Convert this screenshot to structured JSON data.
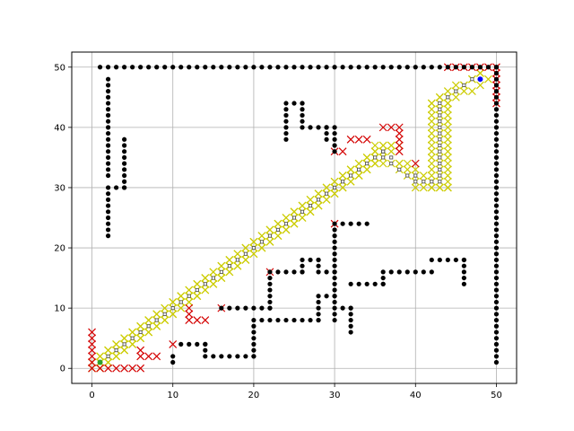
{
  "chart_data": {
    "type": "scatter",
    "title": "",
    "xlabel": "",
    "ylabel": "",
    "xlim": [
      -2.5,
      52.5
    ],
    "ylim": [
      -2.5,
      52.5
    ],
    "grid": true,
    "xticks": [
      0,
      10,
      20,
      30,
      40,
      50
    ],
    "yticks": [
      0,
      10,
      20,
      30,
      40,
      50
    ],
    "colors": {
      "obstacles": "#000000",
      "closed_set": "#cccc00",
      "open_set": "#d40000",
      "path": "#555555",
      "start": "#2ca02c",
      "goal": "#0000ff"
    },
    "series": [
      {
        "marker": "dot",
        "segments": [
          [
            [
              1,
              50
            ],
            [
              50,
              50
            ]
          ],
          [
            [
              50,
              50
            ],
            [
              50,
              1
            ]
          ],
          [
            [
              2,
              48
            ],
            [
              2,
              32
            ]
          ],
          [
            [
              2,
              30
            ],
            [
              2,
              22
            ]
          ],
          [
            [
              3,
              30
            ],
            [
              4,
              30
            ]
          ],
          [
            [
              4,
              38
            ],
            [
              4,
              30
            ]
          ],
          [
            [
              24,
              44
            ],
            [
              24,
              38
            ]
          ],
          [
            [
              25,
              44
            ],
            [
              26,
              44
            ]
          ],
          [
            [
              26,
              44
            ],
            [
              26,
              40
            ]
          ],
          [
            [
              27,
              40
            ],
            [
              29,
              40
            ]
          ],
          [
            [
              29,
              40
            ],
            [
              29,
              38
            ]
          ],
          [
            [
              30,
              40
            ],
            [
              30,
              36
            ]
          ],
          [
            [
              10,
              2
            ],
            [
              10,
              1
            ]
          ],
          [
            [
              11,
              4
            ],
            [
              14,
              4
            ]
          ],
          [
            [
              14,
              4
            ],
            [
              14,
              2
            ]
          ],
          [
            [
              15,
              2
            ],
            [
              20,
              2
            ]
          ],
          [
            [
              20,
              2
            ],
            [
              20,
              8
            ]
          ],
          [
            [
              21,
              8
            ],
            [
              28,
              8
            ]
          ],
          [
            [
              28,
              8
            ],
            [
              28,
              12
            ]
          ],
          [
            [
              29,
              12
            ],
            [
              30,
              12
            ]
          ],
          [
            [
              30,
              24
            ],
            [
              30,
              8
            ]
          ],
          [
            [
              31,
              24
            ],
            [
              34,
              24
            ]
          ],
          [
            [
              31,
              10
            ],
            [
              32,
              10
            ]
          ],
          [
            [
              32,
              10
            ],
            [
              32,
              6
            ]
          ],
          [
            [
              32,
              14
            ],
            [
              36,
              14
            ]
          ],
          [
            [
              36,
              14
            ],
            [
              36,
              16
            ]
          ],
          [
            [
              37,
              16
            ],
            [
              42,
              16
            ]
          ],
          [
            [
              42,
              18
            ],
            [
              46,
              18
            ]
          ],
          [
            [
              46,
              18
            ],
            [
              46,
              14
            ]
          ],
          [
            [
              16,
              10
            ],
            [
              22,
              10
            ]
          ],
          [
            [
              22,
              16
            ],
            [
              22,
              10
            ]
          ],
          [
            [
              23,
              16
            ],
            [
              26,
              16
            ]
          ],
          [
            [
              26,
              16
            ],
            [
              26,
              18
            ]
          ],
          [
            [
              27,
              18
            ],
            [
              28,
              18
            ]
          ],
          [
            [
              28,
              18
            ],
            [
              28,
              16
            ]
          ],
          [
            [
              29,
              16
            ],
            [
              30,
              16
            ]
          ]
        ]
      },
      {
        "marker": "x",
        "segments": [
          [
            [
              0,
              6
            ],
            [
              0,
              0
            ]
          ],
          [
            [
              1,
              0
            ],
            [
              6,
              0
            ]
          ],
          [
            [
              6,
              3
            ],
            [
              6,
              2
            ]
          ],
          [
            [
              7,
              2
            ],
            [
              8,
              2
            ]
          ],
          [
            [
              10,
              4
            ],
            [
              10,
              4
            ]
          ],
          [
            [
              12,
              10
            ],
            [
              12,
              8
            ]
          ],
          [
            [
              13,
              8
            ],
            [
              14,
              8
            ]
          ],
          [
            [
              16,
              10
            ],
            [
              16,
              10
            ]
          ],
          [
            [
              22,
              16
            ],
            [
              22,
              16
            ]
          ],
          [
            [
              30,
              24
            ],
            [
              30,
              24
            ]
          ],
          [
            [
              30,
              36
            ],
            [
              31,
              36
            ]
          ],
          [
            [
              32,
              38
            ],
            [
              34,
              38
            ]
          ],
          [
            [
              36,
              40
            ],
            [
              38,
              40
            ]
          ],
          [
            [
              38,
              39
            ],
            [
              38,
              36
            ]
          ],
          [
            [
              40,
              34
            ],
            [
              40,
              34
            ]
          ],
          [
            [
              44,
              50
            ],
            [
              50,
              50
            ]
          ],
          [
            [
              50,
              49
            ],
            [
              50,
              44
            ]
          ]
        ]
      },
      {
        "marker": "x",
        "segments": [
          [
            [
              0,
              0
            ],
            [
              36,
              36
            ]
          ],
          [
            [
              1,
              1
            ],
            [
              37,
              37
            ]
          ],
          [
            [
              2,
              2
            ],
            [
              36,
              36
            ]
          ],
          [
            [
              1,
              0
            ],
            [
              36,
              35
            ]
          ],
          [
            [
              0,
              1
            ],
            [
              35,
              36
            ]
          ],
          [
            [
              2,
              1
            ],
            [
              37,
              36
            ]
          ],
          [
            [
              1,
              2
            ],
            [
              36,
              37
            ]
          ],
          [
            [
              35,
              37
            ],
            [
              38,
              37
            ]
          ],
          [
            [
              35,
              34
            ],
            [
              38,
              34
            ]
          ],
          [
            [
              38,
              34
            ],
            [
              41,
              31
            ]
          ],
          [
            [
              38,
              33
            ],
            [
              40,
              31
            ]
          ],
          [
            [
              39,
              34
            ],
            [
              42,
              31
            ]
          ],
          [
            [
              40,
              30
            ],
            [
              44,
              30
            ]
          ],
          [
            [
              42,
              30
            ],
            [
              42,
              44
            ]
          ],
          [
            [
              43,
              30
            ],
            [
              43,
              45
            ]
          ],
          [
            [
              44,
              30
            ],
            [
              44,
              44
            ]
          ],
          [
            [
              42,
              44
            ],
            [
              48,
              49
            ]
          ],
          [
            [
              43,
              43
            ],
            [
              49,
              48
            ]
          ],
          [
            [
              44,
              45
            ],
            [
              48,
              49
            ]
          ]
        ]
      },
      {
        "marker": "small-square",
        "segments": [
          [
            [
              1,
              1
            ],
            [
              36,
              36
            ]
          ],
          [
            [
              36,
              36
            ],
            [
              36,
              35
            ]
          ],
          [
            [
              37,
              35
            ],
            [
              37,
              34
            ]
          ],
          [
            [
              38,
              33
            ],
            [
              39,
              32
            ]
          ],
          [
            [
              40,
              32
            ],
            [
              40,
              31
            ]
          ],
          [
            [
              41,
              31
            ],
            [
              42,
              31
            ]
          ],
          [
            [
              43,
              31
            ],
            [
              43,
              44
            ]
          ],
          [
            [
              44,
              45
            ],
            [
              47,
              48
            ]
          ]
        ]
      },
      {
        "marker": "start",
        "segments": [
          [
            [
              1,
              1
            ],
            [
              1,
              1
            ]
          ]
        ]
      },
      {
        "marker": "goal",
        "segments": [
          [
            [
              48,
              48
            ],
            [
              48,
              48
            ]
          ]
        ]
      }
    ]
  }
}
